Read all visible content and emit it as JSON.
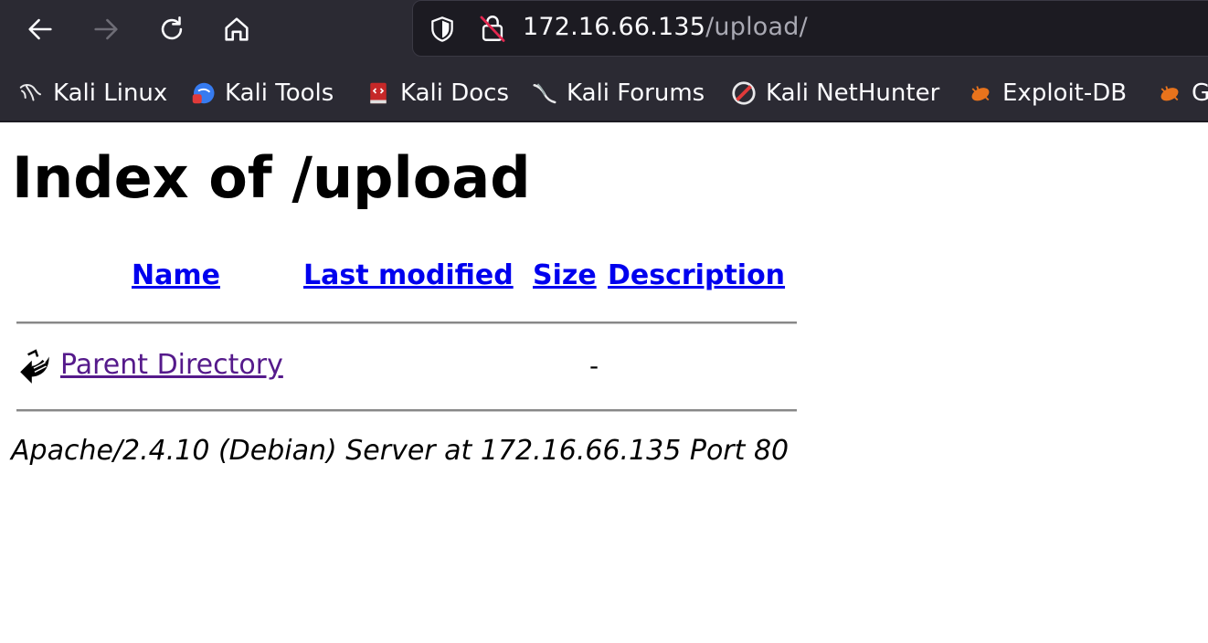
{
  "browser": {
    "url_host": "172.16.66.135",
    "url_path": "/upload/",
    "nav": {
      "back_icon": "arrow-left-icon",
      "forward_icon": "arrow-right-icon",
      "reload_icon": "reload-icon",
      "home_icon": "home-icon"
    },
    "bookmarks": [
      {
        "label": "Kali Linux",
        "icon": "kali-dragon-icon"
      },
      {
        "label": "Kali Tools",
        "icon": "kali-tools-icon"
      },
      {
        "label": "Kali Docs",
        "icon": "kali-docs-icon"
      },
      {
        "label": "Kali Forums",
        "icon": "kali-forums-icon"
      },
      {
        "label": "Kali NetHunter",
        "icon": "nethunter-icon"
      },
      {
        "label": "Exploit-DB",
        "icon": "exploit-db-icon"
      },
      {
        "label": "G",
        "icon": "exploit-db-icon"
      }
    ],
    "colors": {
      "chrome_bg": "#2b2a33",
      "urlbar_bg": "#1c1b22",
      "link": "#0000ee",
      "visited_link": "#551a8b"
    }
  },
  "page": {
    "title": "Index of /upload",
    "columns": {
      "name": "Name",
      "last_modified": "Last modified",
      "size": "Size",
      "description": "Description"
    },
    "rows": [
      {
        "name": "Parent Directory",
        "icon": "back-arrow-icon",
        "last_modified": "",
        "size": "-",
        "description": ""
      }
    ],
    "footer": "Apache/2.4.10 (Debian) Server at 172.16.66.135 Port 80"
  }
}
